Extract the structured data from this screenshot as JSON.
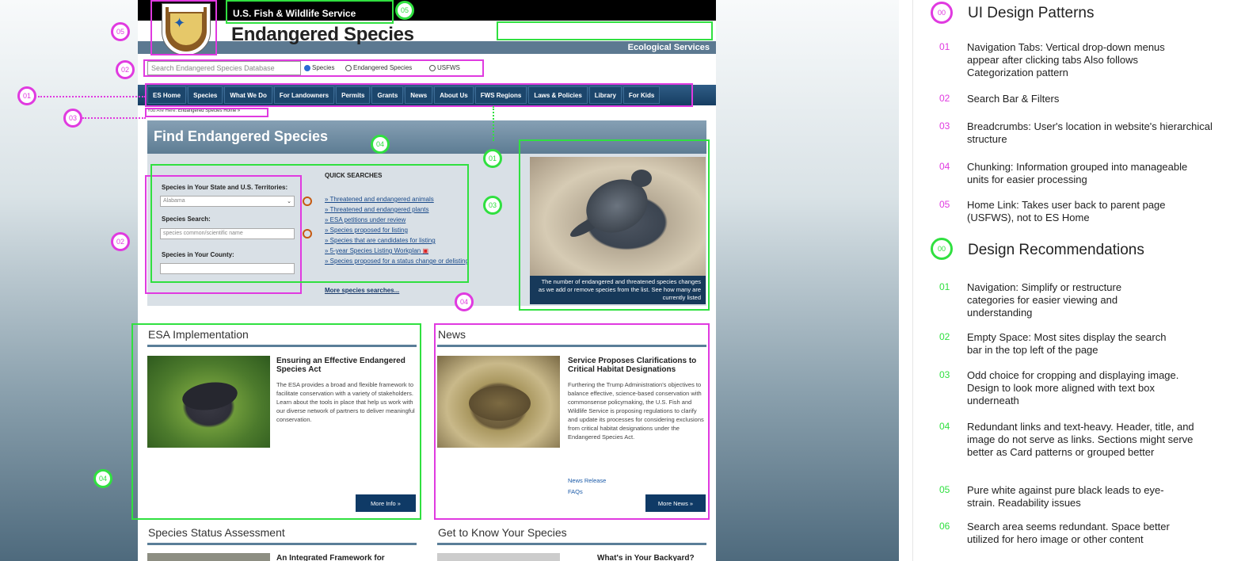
{
  "site": {
    "agency": "U.S. Fish & Wildlife Service",
    "title": "Endangered Species",
    "subtitle": "Ecological Services",
    "search": {
      "placeholder": "Search Endangered Species Database",
      "radios": [
        "Species",
        "Endangered Species",
        "USFWS"
      ],
      "selected": "Species"
    },
    "nav": [
      "ES Home",
      "Species",
      "What We Do",
      "For Landowners",
      "Permits",
      "Grants",
      "News",
      "About Us",
      "FWS Regions",
      "Laws & Policies",
      "Library",
      "For Kids"
    ],
    "breadcrumb": {
      "prefix": "You Are Here:",
      "current": "Endangered Species Home »"
    },
    "find": {
      "title": "Find Endangered Species",
      "state_label": "Species in Your State and U.S. Territories:",
      "state_value": "Alabama",
      "species_label": "Species Search:",
      "species_placeholder": "species common/scientific name",
      "county_label": "Species in Your County:",
      "quick_title": "QUICK SEARCHES",
      "quick": [
        "Threatened and endangered animals",
        "Threatened and endangered plants",
        "ESA petitions under review",
        "Species proposed for listing",
        "Species that are candidates for listing",
        "5-year Species Listing Workplan",
        "Species proposed for a status change or delisting"
      ],
      "more": "More species searches...",
      "caption": "The number of endangered and threatened species changes as we add or remove species from the list. See how many are currently listed"
    },
    "esa": {
      "section": "ESA Implementation",
      "heading": "Ensuring an Effective Endangered Species Act",
      "body": "The ESA provides a broad and flexible framework to facilitate conservation with a variety of stakeholders. Learn about the tools in place that help us work with our diverse network of partners to deliver meaningful conservation.",
      "button": "More Info »"
    },
    "news": {
      "section": "News",
      "heading": "Service Proposes Clarifications to Critical Habitat Designations",
      "body": "Furthering the Trump Administration's objectives to balance effective, science-based conservation with commonsense policymaking, the U.S. Fish and Wildlife Service is proposing regulations to clarify and update its processes for considering exclusions from critical habitat designations under the Endangered Species Act.",
      "links": [
        "News Release",
        "FAQs"
      ],
      "button": "More News »"
    },
    "ssa": {
      "section": "Species Status Assessment",
      "heading": "An Integrated Framework for"
    },
    "know": {
      "section": "Get to Know Your Species",
      "heading": "What's in Your Backyard?"
    }
  },
  "annotations": {
    "magenta": [
      "05",
      "02",
      "01",
      "03",
      "02",
      "04"
    ],
    "green": [
      "05",
      "01",
      "03",
      "04",
      "04"
    ]
  },
  "panel": {
    "patterns_marker": "00",
    "patterns_title": "UI Design Patterns",
    "patterns": [
      {
        "num": "01",
        "text": "Navigation Tabs: Vertical drop-down menus appear after clicking tabs Also follows Categorization pattern"
      },
      {
        "num": "02",
        "text": "Search Bar & Filters"
      },
      {
        "num": "03",
        "text": "Breadcrumbs:  User's location in website's hierarchical structure"
      },
      {
        "num": "04",
        "text": "Chunking: Information grouped into manageable units for easier processing"
      },
      {
        "num": "05",
        "text": "Home Link: Takes user back to parent page (USFWS), not to ES Home"
      }
    ],
    "rec_marker": "00",
    "rec_title": "Design Recommendations",
    "recs": [
      {
        "num": "01",
        "text": "Navigation: Simplify or restructure categories for easier viewing and understanding"
      },
      {
        "num": "02",
        "text": "Empty Space: Most sites display the search bar in the top left of the page"
      },
      {
        "num": "03",
        "text": "Odd choice for cropping and displaying image.  Design to look more aligned with text box underneath"
      },
      {
        "num": "04",
        "text": "Redundant links and text-heavy.  Header, title, and image do not serve as links. Sections might serve better as Card patterns or grouped better"
      },
      {
        "num": "05",
        "text": "Pure white against pure black leads to eye-strain.  Readability issues"
      },
      {
        "num": "06",
        "text": "Search area seems redundant.  Space better utilized for hero image or other content"
      }
    ]
  },
  "colors": {
    "pattern_accent": "#e03ae0",
    "recommendation_accent": "#30e040",
    "nav": "#1c466c"
  },
  "icons": [
    "fws-logo",
    "search-magnifier-icon",
    "pdf-icon",
    "chevron-down-icon"
  ]
}
